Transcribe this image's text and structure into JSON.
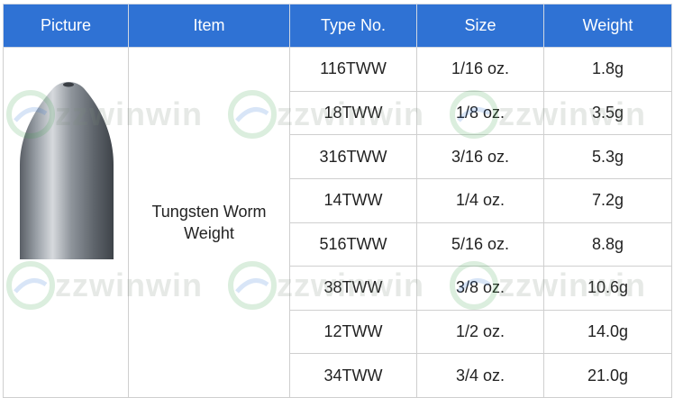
{
  "table": {
    "headers": [
      "Picture",
      "Item",
      "Type No.",
      "Size",
      "Weight"
    ],
    "item": "Tungsten Worm Weight",
    "rows": [
      {
        "type_no": "116TWW",
        "size": "1/16 oz.",
        "weight": "1.8g"
      },
      {
        "type_no": "18TWW",
        "size": "1/8 oz.",
        "weight": "3.5g"
      },
      {
        "type_no": "316TWW",
        "size": "3/16 oz.",
        "weight": "5.3g"
      },
      {
        "type_no": "14TWW",
        "size": "1/4 oz.",
        "weight": "7.2g"
      },
      {
        "type_no": "516TWW",
        "size": "5/16 oz.",
        "weight": "8.8g"
      },
      {
        "type_no": "38TWW",
        "size": "3/8 oz.",
        "weight": "10.6g"
      },
      {
        "type_no": "12TWW",
        "size": "1/2 oz.",
        "weight": "14.0g"
      },
      {
        "type_no": "34TWW",
        "size": "3/4 oz.",
        "weight": "21.0g"
      }
    ]
  },
  "watermark": "zzwinwin",
  "colors": {
    "header_bg": "#2f72d4",
    "header_text": "#ffffff",
    "border": "#cfcfcf"
  }
}
